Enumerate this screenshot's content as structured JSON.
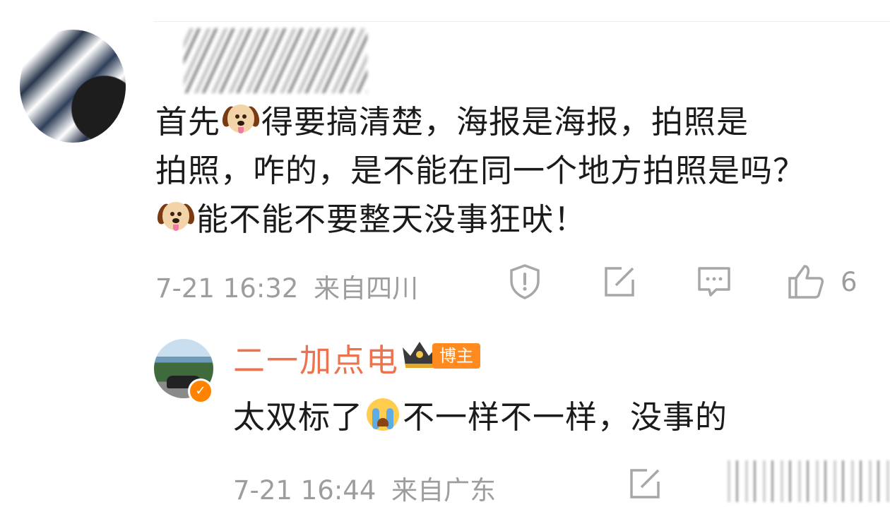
{
  "comment": {
    "line1_a": "首先",
    "line1_b": "得要搞清楚，海报是海报，拍照是",
    "line2": "拍照，咋的，是不能在同一个地方拍照是吗？",
    "line3": "能不能不要整天没事狂吠！",
    "emoji": "dog-face-icon",
    "time": "7-21 16:32",
    "location": "来自四川",
    "like_count": "6"
  },
  "reply": {
    "author": "二一加点电",
    "author_tag": "博主",
    "text_a": "太双标了",
    "text_b": "不一样不一样，没事的",
    "emoji": "crying-face-icon",
    "time": "7-21 16:44",
    "location": "来自广东"
  },
  "colors": {
    "author_name": "#eb7350",
    "tag_bg": "#ff8a1f",
    "meta_text": "#9d9d9d",
    "verified_badge": "#ff8200"
  }
}
